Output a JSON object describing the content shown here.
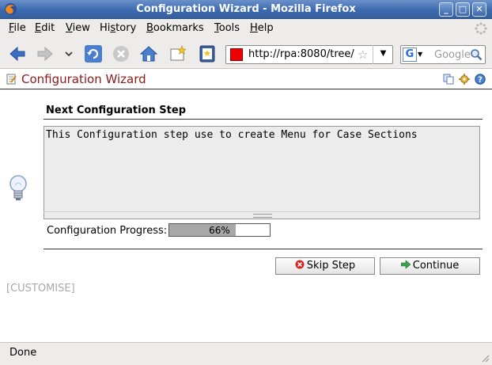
{
  "window": {
    "title": "Configuration Wizard - Mozilla Firefox",
    "minimize": "_",
    "maximize": "□",
    "close": "✕"
  },
  "menu": {
    "items": [
      {
        "label": "File",
        "key": "F",
        "rest": "ile"
      },
      {
        "label": "Edit",
        "key": "E",
        "rest": "dit"
      },
      {
        "label": "View",
        "key": "V",
        "rest": "iew"
      },
      {
        "label": "History",
        "key": "s",
        "pre": "Hi",
        "rest": "tory"
      },
      {
        "label": "Bookmarks",
        "key": "B",
        "rest": "ookmarks"
      },
      {
        "label": "Tools",
        "key": "T",
        "rest": "ools"
      },
      {
        "label": "Help",
        "key": "H",
        "rest": "elp"
      }
    ]
  },
  "toolbar": {
    "url": "http://rpa:8080/tree/",
    "search_placeholder": "Google"
  },
  "page": {
    "header_title": "Configuration Wizard",
    "step_title": "Next Configuration Step",
    "description": "This Configuration step use to create Menu for Case Sections",
    "progress_label": "Configuration Progress:",
    "progress_value": 66,
    "progress_text": "66%",
    "skip_label": "Skip Step",
    "continue_label": "Continue",
    "customise_label": "[CUSTOMISE]"
  },
  "status": {
    "text": "Done"
  },
  "colors": {
    "title_accent": "#8b1a1a",
    "progress_fill": "#a8a8a8"
  }
}
